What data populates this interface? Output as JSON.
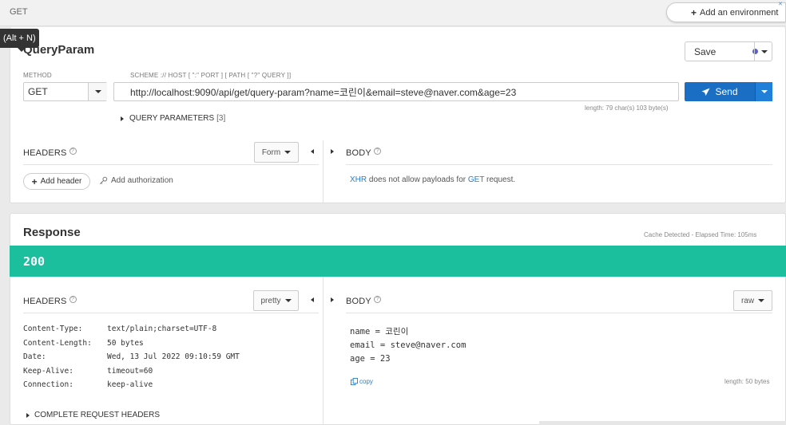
{
  "top": {
    "tab_label": "GET",
    "env_button": "Add an environment",
    "env_close": "✕",
    "tooltip": "(Alt + N)"
  },
  "request": {
    "title": "QueryParam",
    "save_label": "Save",
    "method_label": "METHOD",
    "scheme_hint": "SCHEME :// HOST [ \":\" PORT ] [ PATH [ \"?\" QUERY ]]",
    "method_value": "GET",
    "url_value": "http://localhost:9090/api/get/query-param?name=코린이&email=steve@naver.com&age=23",
    "send_label": "Send",
    "length_info": "length: 79 char(s) 103 byte(s)",
    "query_params_label": "QUERY PARAMETERS",
    "query_params_count": "[3]",
    "headers_label": "HEADERS",
    "headers_mode": "Form",
    "body_label": "BODY",
    "add_header_label": "Add header",
    "add_auth_label": "Add authorization",
    "body_notice": {
      "xhr": "XHR",
      "middle": " does not allow payloads for ",
      "method": "GET",
      "end": " request."
    }
  },
  "response": {
    "title": "Response",
    "cache_info": "Cache Detected - Elapsed Time: 105ms",
    "status_code": "200",
    "status_color": "#1bbf9e",
    "headers_label": "HEADERS",
    "headers_mode": "pretty",
    "body_label": "BODY",
    "body_mode": "raw",
    "headers": [
      {
        "name": "Content-Type:",
        "value": "text/plain;charset=UTF-8"
      },
      {
        "name": "Content-Length:",
        "value": "50 bytes"
      },
      {
        "name": "Date:",
        "value": "Wed, 13 Jul 2022 09:10:59 GMT"
      },
      {
        "name": "Keep-Alive:",
        "value": "timeout=60"
      },
      {
        "name": "Connection:",
        "value": "keep-alive"
      }
    ],
    "body_lines": [
      "name = 코린이",
      "email = steve@naver.com",
      "age = 23"
    ],
    "copy_label": "copy",
    "body_length": "length: 50 bytes",
    "complete_headers_label": "COMPLETE REQUEST HEADERS"
  },
  "icons": {
    "plus": "plus-icon",
    "send": "paper-plane-icon",
    "key": "key-icon",
    "copy": "copy-icon",
    "help": "help-circle-icon"
  },
  "colors": {
    "accent": "#1a6ec4",
    "status_ok": "#1bbf9e",
    "save_dot": "#5b5fcf",
    "link": "#2a7dc8"
  }
}
